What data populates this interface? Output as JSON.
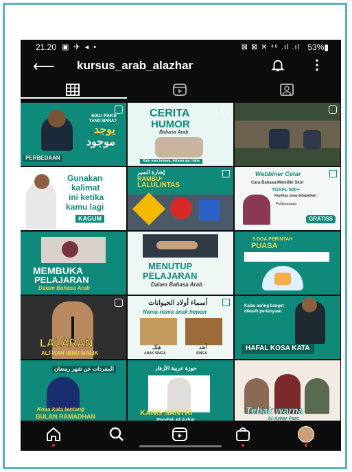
{
  "status": {
    "time": "21.20",
    "icons": "▣ ✈ ◂ •",
    "signal": "⊠ ⊠ ✕ ⁴⁶ .ıl .ıl",
    "battery": "53%▮"
  },
  "header": {
    "username": "kursus_arab_alazhar"
  },
  "tabs": [
    {
      "name": "grid-icon"
    },
    {
      "name": "reels-icon"
    },
    {
      "name": "tagged-icon"
    }
  ],
  "posts": [
    {
      "lines": [
        "MAU PAKE",
        "YANG MANA?",
        "يوجد",
        "موجود",
        "PERBEDAAN"
      ],
      "bg": "#0f8a7a"
    },
    {
      "lines": [
        "CERITA",
        "HUMOR",
        "Bahasa Arab",
        "Kalo mau ketawa, ketawa aja. haha"
      ],
      "bg": "#eaf6f3"
    },
    {
      "lines": [],
      "bg": "#3b4d37"
    },
    {
      "lines": [
        "Gunakan",
        "kalimat",
        "ini ketika",
        "kamu lagi",
        "KAGUM"
      ],
      "bg": "#ffffff"
    },
    {
      "lines": [
        "إشارة السير",
        "RAMBU²",
        "LALULINTAS"
      ],
      "bg": "#0f8a7a"
    },
    {
      "lines": [
        "Webbiner Cetar",
        "Cara Bahasa Memiliki Skor",
        "TOAFL 500+",
        "Fasilitas yang didapatkan :",
        "Pelaksanaan",
        "GRATISS"
      ],
      "bg": "#f4f8f6"
    },
    {
      "lines": [
        "MEMBUKA",
        "PELAJARAN",
        "Dalam Bahasa Arab"
      ],
      "bg": "#0f8a7a"
    },
    {
      "lines": [
        "MENUTUP",
        "PELAJARAN",
        "Dalam Bahasa Arab"
      ],
      "bg": "#eef7f4"
    },
    {
      "lines": [
        "5 DOA PERINTAH",
        "PUASA"
      ],
      "bg": "#0f8a7a"
    },
    {
      "lines": [
        "LALARAN",
        "ALFIYAH IBNU MALIK"
      ],
      "bg": "#2f2f2f"
    },
    {
      "lines": [
        "أسماء أولاد الحيوانات",
        "Nama-nama anak hewan",
        "شِبْل",
        "أَسَد",
        "ANAK SINGA",
        "SINGA"
      ],
      "bg": "#eef7f4"
    },
    {
      "lines": [
        "Kalau sering banget",
        "dikasih pertanyaan",
        "HAFAL KOSA KATA"
      ],
      "bg": "#0f8a7a"
    },
    {
      "lines": [
        "المفردات عن شهر رمضان",
        "Kosa kata tentang",
        "BULAN RAMADHAN"
      ],
      "bg": "#0f8a7a"
    },
    {
      "lines": [
        "حوزة عربية الأزهار",
        "KANG SANTRI",
        "Pondok Al-Azhar"
      ],
      "bg": "#0f8a7a"
    },
    {
      "lines": [
        "Tebak warna",
        "Al-Azhar Parc"
      ],
      "bg": "#f2ebe3"
    }
  ],
  "nav": [
    {
      "name": "home-icon"
    },
    {
      "name": "search-icon"
    },
    {
      "name": "reels-icon"
    },
    {
      "name": "shop-icon"
    },
    {
      "name": "profile-avatar"
    }
  ],
  "colors": {
    "accent": "#0f8a7a",
    "frame": "#5aafc5"
  }
}
